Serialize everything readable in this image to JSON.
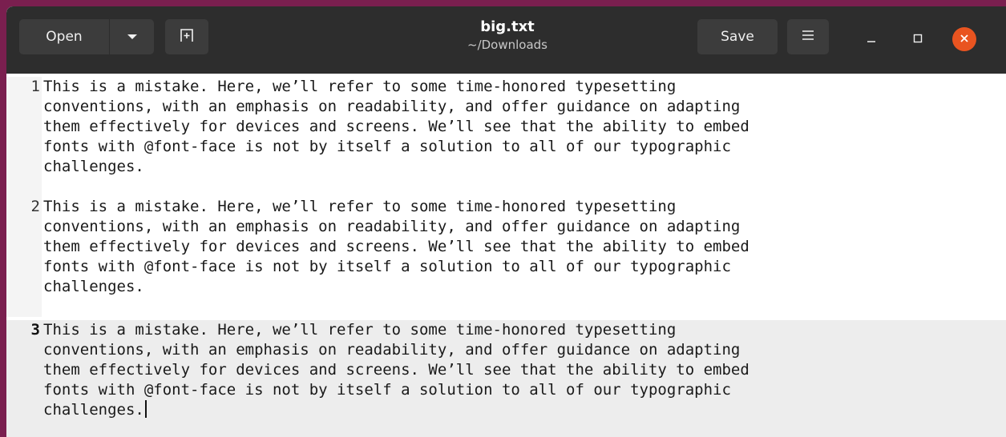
{
  "header": {
    "open_label": "Open",
    "save_label": "Save",
    "title": "big.txt",
    "subtitle": "~/Downloads"
  },
  "icons": {
    "open_dropdown": "chevron-down-icon",
    "new_tab": "new-tab-icon",
    "menu": "hamburger-menu-icon",
    "minimize": "minimize-icon",
    "maximize": "maximize-icon",
    "close": "close-icon"
  },
  "colors": {
    "headerbar": "#2d2d2d",
    "close_button": "#e95420",
    "current_line": "#ededed"
  },
  "editor": {
    "lines": [
      {
        "number": "1",
        "wrapped": [
          "This is a mistake. Here, we’ll refer to some time-honored typesetting",
          "conventions, with an emphasis on readability, and offer guidance on adapting",
          "them effectively for devices and screens. We’ll see that the ability to embed",
          "fonts with @font-face is not by itself a solution to all of our typographic",
          "challenges."
        ]
      },
      {
        "number": "2",
        "wrapped": [
          "This is a mistake. Here, we’ll refer to some time-honored typesetting",
          "conventions, with an emphasis on readability, and offer guidance on adapting",
          "them effectively for devices and screens. We’ll see that the ability to embed",
          "fonts with @font-face is not by itself a solution to all of our typographic",
          "challenges."
        ]
      },
      {
        "number": "3",
        "wrapped": [
          "This is a mistake. Here, we’ll refer to some time-honored typesetting",
          "conventions, with an emphasis on readability, and offer guidance on adapting",
          "them effectively for devices and screens. We’ll see that the ability to embed",
          "fonts with @font-face is not by itself a solution to all of our typographic",
          "challenges."
        ]
      }
    ]
  }
}
